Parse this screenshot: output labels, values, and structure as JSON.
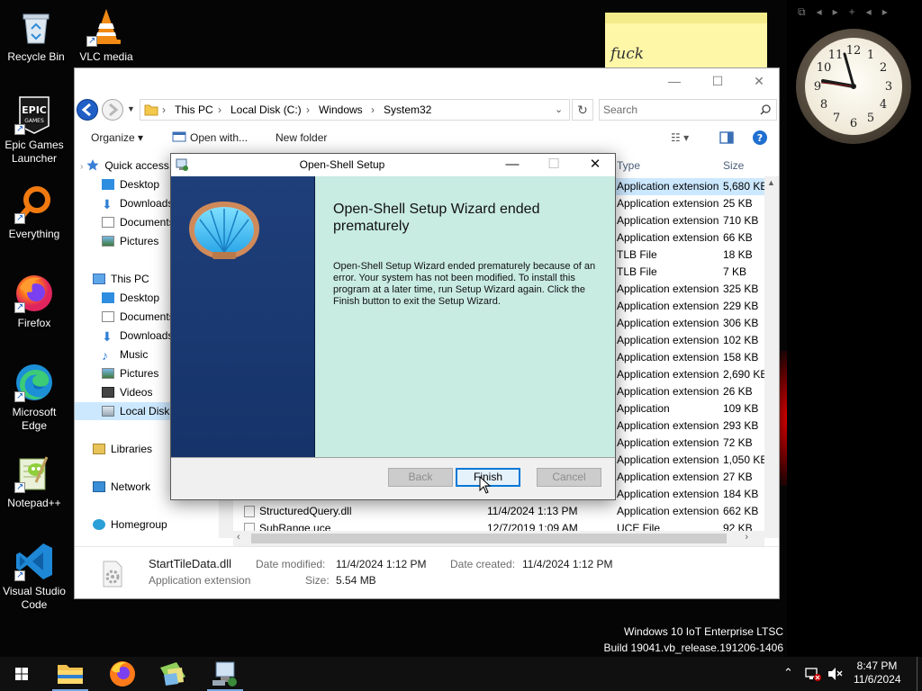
{
  "desktop": {
    "icons": [
      {
        "label": "Recycle Bin"
      },
      {
        "label": "VLC media"
      },
      {
        "label": "Epic Games Launcher"
      },
      {
        "label": "Everything"
      },
      {
        "label": "Firefox"
      },
      {
        "label": "Microsoft Edge"
      },
      {
        "label": "Notepad++"
      },
      {
        "label": "Visual Studio Code"
      }
    ],
    "sticky_note_text": "fuck",
    "watermark": {
      "line1": "Windows 10 IoT Enterprise LTSC",
      "line2": "Build 19041.vb_release.191206-1406"
    }
  },
  "explorer": {
    "window_controls": {
      "minimize": "—",
      "maximize": "☐",
      "close": "✕"
    },
    "breadcrumb": [
      "This PC",
      "Local Disk (C:)",
      "Windows",
      "System32"
    ],
    "search_placeholder": "Search",
    "toolbar": {
      "organize": "Organize ▾",
      "open_with": "Open with...",
      "new_folder": "New folder"
    },
    "nav": [
      {
        "label": "Quick access"
      },
      {
        "label": "Desktop"
      },
      {
        "label": "Downloads"
      },
      {
        "label": "Documents"
      },
      {
        "label": "Pictures"
      },
      {
        "label": "This PC"
      },
      {
        "label": "Desktop"
      },
      {
        "label": "Documents"
      },
      {
        "label": "Downloads"
      },
      {
        "label": "Music"
      },
      {
        "label": "Pictures"
      },
      {
        "label": "Videos"
      },
      {
        "label": "Local Disk (C:)"
      },
      {
        "label": "Libraries"
      },
      {
        "label": "Network"
      },
      {
        "label": "Homegroup"
      }
    ],
    "columns": {
      "type": "Type",
      "size": "Size"
    },
    "rows": [
      {
        "name": "",
        "date": "",
        "type": "Application extension",
        "size": "5,680 KB"
      },
      {
        "name": "",
        "date": "",
        "type": "Application extension",
        "size": "25 KB"
      },
      {
        "name": "",
        "date": "",
        "type": "Application extension",
        "size": "710 KB"
      },
      {
        "name": "",
        "date": "",
        "type": "Application extension",
        "size": "66 KB"
      },
      {
        "name": "",
        "date": "",
        "type": "TLB File",
        "size": "18 KB"
      },
      {
        "name": "",
        "date": "",
        "type": "TLB File",
        "size": "7 KB"
      },
      {
        "name": "",
        "date": "",
        "type": "Application extension",
        "size": "325 KB"
      },
      {
        "name": "",
        "date": "",
        "type": "Application extension",
        "size": "229 KB"
      },
      {
        "name": "",
        "date": "",
        "type": "Application extension",
        "size": "306 KB"
      },
      {
        "name": "",
        "date": "",
        "type": "Application extension",
        "size": "102 KB"
      },
      {
        "name": "",
        "date": "",
        "type": "Application extension",
        "size": "158 KB"
      },
      {
        "name": "",
        "date": "",
        "type": "Application extension",
        "size": "2,690 KB"
      },
      {
        "name": "",
        "date": "",
        "type": "Application extension",
        "size": "26 KB"
      },
      {
        "name": "",
        "date": "",
        "type": "Application",
        "size": "109 KB"
      },
      {
        "name": "",
        "date": "",
        "type": "Application extension",
        "size": "293 KB"
      },
      {
        "name": "",
        "date": "",
        "type": "Application extension",
        "size": "72 KB"
      },
      {
        "name": "",
        "date": "",
        "type": "Application extension",
        "size": "1,050 KB"
      },
      {
        "name": "",
        "date": "",
        "type": "Application extension",
        "size": "27 KB"
      },
      {
        "name": "",
        "date": "",
        "type": "Application extension",
        "size": "184 KB"
      },
      {
        "name": "StructuredQuery.dll",
        "date": "11/4/2024 1:13 PM",
        "type": "Application extension",
        "size": "662 KB"
      },
      {
        "name": "SubRange.uce",
        "date": "12/7/2019 1:09 AM",
        "type": "UCE File",
        "size": "92 KB"
      }
    ],
    "details": {
      "filename": "StartTileData.dll",
      "filetype": "Application extension",
      "date_modified_label": "Date modified:",
      "date_modified": "11/4/2024 1:12 PM",
      "date_created_label": "Date created:",
      "date_created": "11/4/2024 1:12 PM",
      "size_label": "Size:",
      "size": "5.54 MB"
    }
  },
  "dialog": {
    "title": "Open-Shell Setup",
    "heading": "Open-Shell Setup Wizard ended prematurely",
    "body": "Open-Shell Setup Wizard ended prematurely because of an error. Your system has not been modified. To install this program at a later time, run Setup Wizard again. Click the Finish button to exit the Setup Wizard.",
    "buttons": {
      "back": "Back",
      "finish": "Finish",
      "cancel": "Cancel"
    }
  },
  "tray": {
    "time": "8:47 PM",
    "date": "11/6/2024"
  },
  "colors": {
    "dialog_body": "#c8ebe2",
    "dialog_banner": "#1f3f7a",
    "selection": "#cce8ff",
    "accent": "#0078d7"
  }
}
